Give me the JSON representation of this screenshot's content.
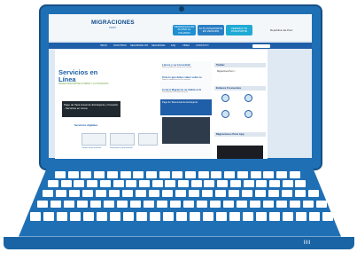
{
  "site": {
    "brand": "MIGRACIONES",
    "brand_sub": "PERÚ",
    "header_buttons": [
      "DENUNCIAS DE ACOSO AL USUARIO",
      "SI TU PASAPORTE ES VENCIDO",
      "VERIFICA TU PASAPORTE"
    ],
    "country": "República del Perú"
  },
  "nav": {
    "items": [
      "INICIO",
      "NOSOTROS",
      "SEGURIDAD INT.",
      "SEGURIDAD",
      "FAQ",
      "VIDEO",
      "CONTÁCTO"
    ]
  },
  "banner": {
    "title": "Servicios en Línea",
    "sub": "MIGRACIONES ENTRE USTEDES Y LA CIUDADANÍA"
  },
  "promo": {
    "text": "Pago de Tasa Anual de Extranjería y Creación - Servicios en Línea"
  },
  "services": {
    "title": "Servicios digitales",
    "items": [
      "Oficina virtual nacional",
      "Formularios y documentos"
    ]
  },
  "col2": {
    "news": [
      {
        "title": "Lahora y ser Honorable!",
        "sub": "Nuevo servicio de atención al usuario"
      },
      {
        "title": "Todo lo que debes saber sobre tu",
        "sub": "Nuevas condiciones en los servicios"
      },
      {
        "title": "Control Migratorio de Salida en E",
        "sub": "Procedimiento de salida del país"
      }
    ],
    "highlight": "Pago de Tasa Anual de Extranjería"
  },
  "col3": {
    "sections": [
      "Twitter",
      "Enlaces Frecuentes",
      "Migraciones Perú App"
    ],
    "twitter_text": "Migraciones Perú ✓",
    "icons": [
      "Agendamiento de citas",
      "Sala de citas",
      "Seguimiento de trámites",
      "Expedientes"
    ]
  },
  "laptop": {
    "badge": "III"
  }
}
